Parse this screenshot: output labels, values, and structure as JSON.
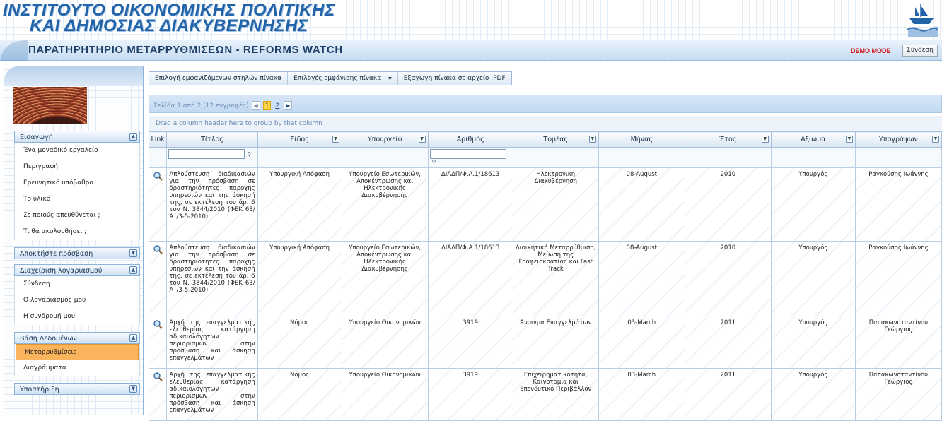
{
  "header": {
    "site_title_line1": "ΙΝΣΤΙΤΟΥΤΟ ΟΙΚΟΝΟΜΙΚΗΣ ΠΟΛΙΤΙΚΗΣ",
    "site_title_line2": "ΚΑΙ ΔΗΜΟΣΙΑΣ ΔΙΑΚΥΒΕΡΝΗΣΗΣ",
    "page_title": "ΠΑΡΑΤΗΡΗΤΗΡΙΟ ΜΕΤΑΡΡΥΘΜΙΣΕΩΝ - REFORMS WATCH",
    "demo_mode": "DEMO MODE",
    "login_button": "Σύνδεση",
    "accent_color": "#2364a9",
    "demo_color": "#d0161c"
  },
  "sidebar": {
    "groups": [
      {
        "title": "Εισαγωγή",
        "expanded": true,
        "items": [
          "Ένα μοναδικό εργαλείο",
          "Περιγραφή",
          "Ερευνητικό υπόβαθρο",
          "Το υλικό",
          "Σε ποιούς απευθύνεται ;",
          "Τι θα ακολουθήσει ;"
        ]
      },
      {
        "title": "Αποκτήστε πρόσβαση",
        "expanded": false,
        "items": []
      },
      {
        "title": "Διαχείριση λογαριασμού",
        "expanded": true,
        "items": [
          "Σύνδεση",
          "Ο λογαριασμός μου",
          "Η συνδρομή μου"
        ]
      },
      {
        "title": "Βάση Δεδομένων",
        "expanded": true,
        "items": [
          "Μεταρρυθμίσεις",
          "Διαγράμματα"
        ],
        "selected": "Μεταρρυθμίσεις"
      },
      {
        "title": "Υποστήριξη",
        "expanded": false,
        "items": []
      }
    ],
    "selected_color": "#fbb45c"
  },
  "toolbar": {
    "choose_columns": "Επιλογή εμφανιζόμενων στηλών πίνακα",
    "display_options": "Επιλογές εμφάνισης πίνακα",
    "export_pdf": "Εξαγωγή πίνακα σε αρχείο .PDF"
  },
  "pager": {
    "summary": "Σελίδα 1 από 2 (12 εγγραφές)",
    "pages": [
      "1",
      "2"
    ],
    "current_page": "1"
  },
  "group_panel": {
    "hint": "Drag a column header here to group by that column"
  },
  "grid": {
    "columns": [
      "Link",
      "Τίτλος",
      "Είδος",
      "Υπουργείο",
      "Αριθμός",
      "Τομέας",
      "Μήνας",
      "Έτος",
      "Αξίωμα",
      "Υπογράφων"
    ],
    "rows": [
      {
        "title": "Απλούστευση διαδικασιών για την πρόσβαση σε δραστηριότητες παροχής υπηρεσιών και την άσκησή της, σε εκτέλεση του άρ. 6 του Ν. 3844/2010 (ΦΕΚ 63/ Α΄/3-5-2010).",
        "type": "Υπουργική Απόφαση",
        "ministry": "Υπουργείο Εσωτερικών, Αποκέντρωσης και Ηλεκτρονικής Διακυβέρνησης",
        "number": "ΔΙΑΔΠ/Φ.Α.1/18613",
        "sector": "Ηλεκτρονική Διακυβέρνηση",
        "month": "08-August",
        "year": "2010",
        "office": "Υπουργός",
        "signatory": "Ραγκούσης Ιωάννης"
      },
      {
        "title": "Απλούστευση διαδικασιών για την πρόσβαση σε δραστηριότητες παροχής υπηρεσιών και την άσκησή της, σε εκτέλεση του άρ. 6 του Ν. 3844/2010 (ΦΕΚ 63/ Α΄/3-5-2010).",
        "type": "Υπουργική Απόφαση",
        "ministry": "Υπουργείο Εσωτερικών, Αποκέντρωσης και Ηλεκτρονικής Διακυβέρνησης",
        "number": "ΔΙΑΔΠ/Φ.Α.1/18613",
        "sector": "Διοικητική Μεταρρύθμιση, Μείωση της Γραφειοκρατίας και Fast Track",
        "month": "08-August",
        "year": "2010",
        "office": "Υπουργός",
        "signatory": "Ραγκούσης Ιωάννης"
      },
      {
        "title": "Αρχή της επαγγελματικής ελευθερίας, κατάργηση αδικαιολόγητων περιορισμών στην πρόσβαση και άσκηση επαγγελμάτων",
        "type": "Νόμος",
        "ministry": "Υπουργείο Οικονομικών",
        "number": "3919",
        "sector": "Άνοιγμα Επαγγελμάτων",
        "month": "03-March",
        "year": "2011",
        "office": "Υπουργός",
        "signatory": "Παπακωνσταντίνου Γεώργιος"
      },
      {
        "title": "Αρχή της επαγγελματικής ελευθερίας, κατάργηση αδικαιολόγητων περιορισμών στην πρόσβαση και άσκηση επαγγελμάτων",
        "type": "Νόμος",
        "ministry": "Υπουργείο Οικονομικών",
        "number": "3919",
        "sector": "Επιχειρηματικότητα, Καινοτομία και Επενδυτικό Περιβάλλον",
        "month": "03-March",
        "year": "2011",
        "office": "Υπουργός",
        "signatory": "Παπακωνσταντίνου Γεώργιος"
      }
    ]
  }
}
